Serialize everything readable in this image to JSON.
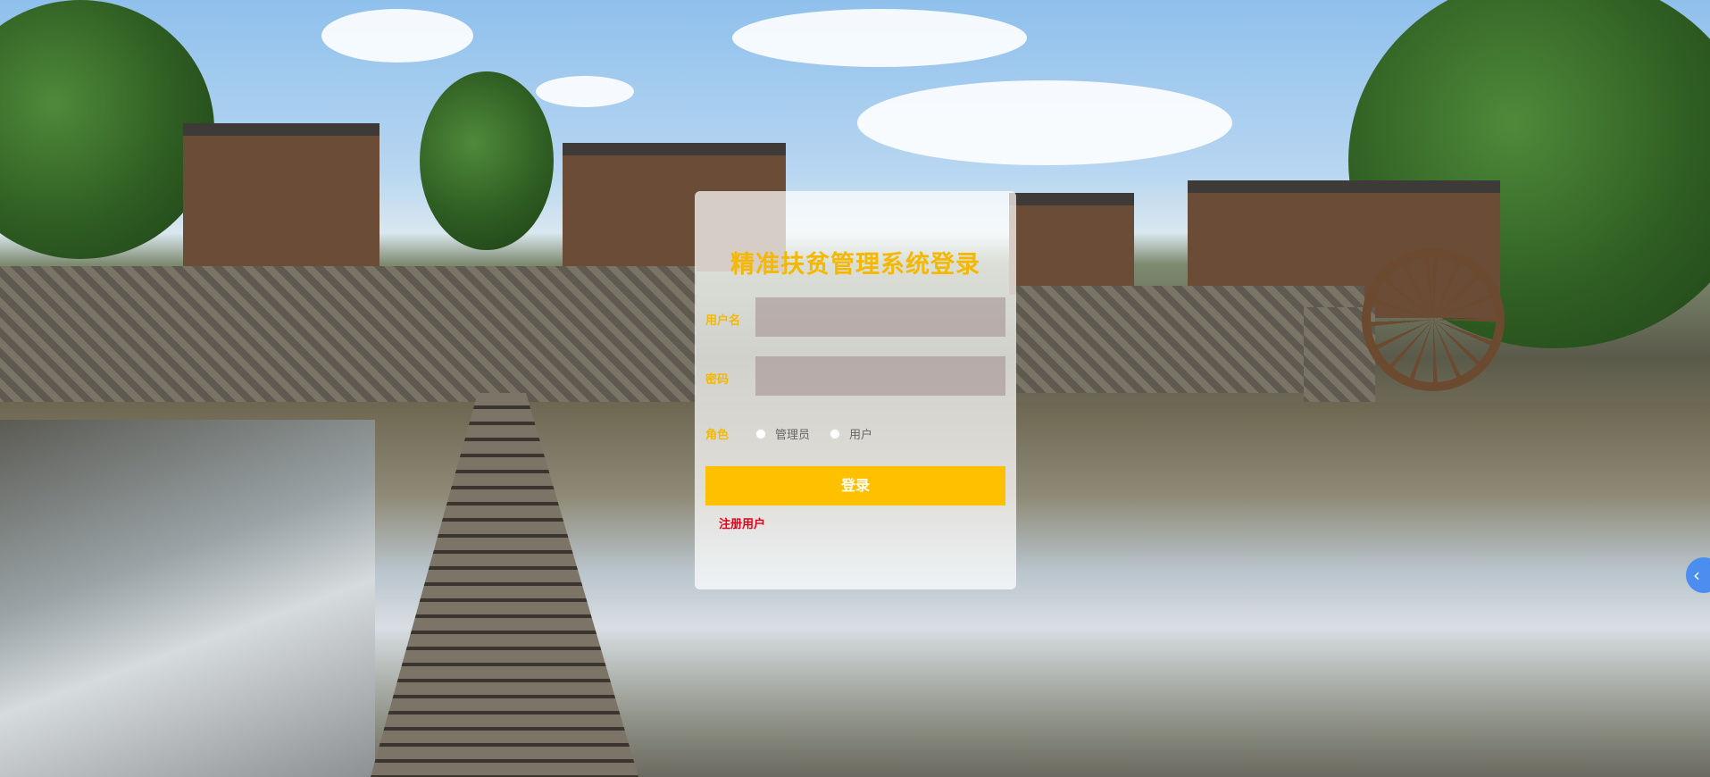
{
  "login": {
    "title": "精准扶贫管理系统登录",
    "username_label": "用户名",
    "username_placeholder": "",
    "password_label": "密码",
    "password_placeholder": "",
    "role_label": "角色",
    "roles": [
      "管理员",
      "用户"
    ],
    "submit_label": "登录",
    "register_label": "注册用户"
  },
  "side_tab": {
    "icon": "chevron-left-icon",
    "glyph": "‹"
  },
  "colors": {
    "accent": "#ffc000",
    "title": "#f5b800",
    "register": "#e3001b",
    "side_tab": "#4b8ef0"
  }
}
